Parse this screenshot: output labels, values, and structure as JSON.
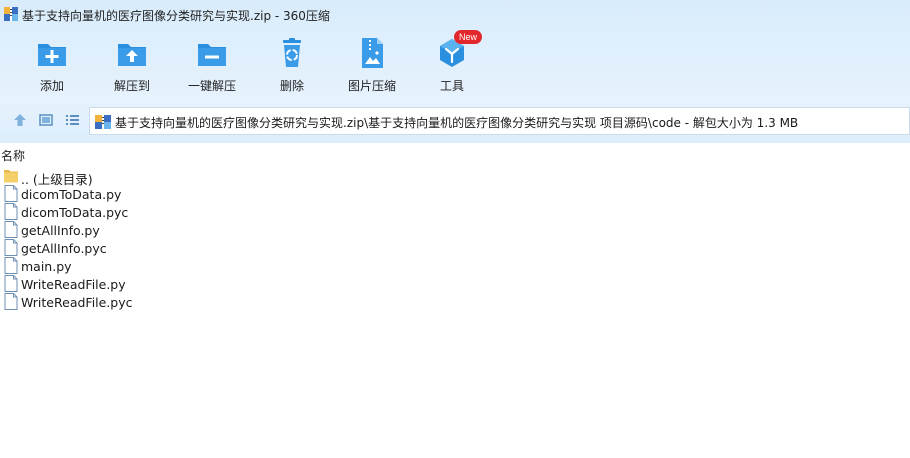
{
  "window": {
    "title": "基于支持向量机的医疗图像分类研究与实现.zip - 360压缩"
  },
  "toolbar": {
    "items": [
      {
        "label": "添加",
        "icon": "add-icon"
      },
      {
        "label": "解压到",
        "icon": "extract-to-icon"
      },
      {
        "label": "一键解压",
        "icon": "one-click-extract-icon"
      },
      {
        "label": "删除",
        "icon": "recycle-bin-icon"
      },
      {
        "label": "图片压缩",
        "icon": "image-compress-icon"
      },
      {
        "label": "工具",
        "icon": "tools-cube-icon"
      }
    ],
    "tools_badge": "New"
  },
  "address": {
    "path": "基于支持向量机的医疗图像分类研究与实现.zip\\基于支持向量机的医疗图像分类研究与实现 项目源码\\code - 解包大小为 1.3 MB"
  },
  "list": {
    "column_name": "名称",
    "items": [
      {
        "name": ".. (上级目录)",
        "type": "parent"
      },
      {
        "name": "dicomToData.py",
        "type": "file"
      },
      {
        "name": "dicomToData.pyc",
        "type": "file"
      },
      {
        "name": "getAllInfo.py",
        "type": "file"
      },
      {
        "name": "getAllInfo.pyc",
        "type": "file"
      },
      {
        "name": "main.py",
        "type": "file"
      },
      {
        "name": "WriteReadFile.py",
        "type": "file"
      },
      {
        "name": "WriteReadFile.pyc",
        "type": "file"
      }
    ]
  },
  "colors": {
    "accent_blue": "#2b8fe0",
    "toolbar_bg": "#e1f0fc",
    "new_badge": "#e2282c",
    "folder_yellow": "#f5cf6a"
  }
}
